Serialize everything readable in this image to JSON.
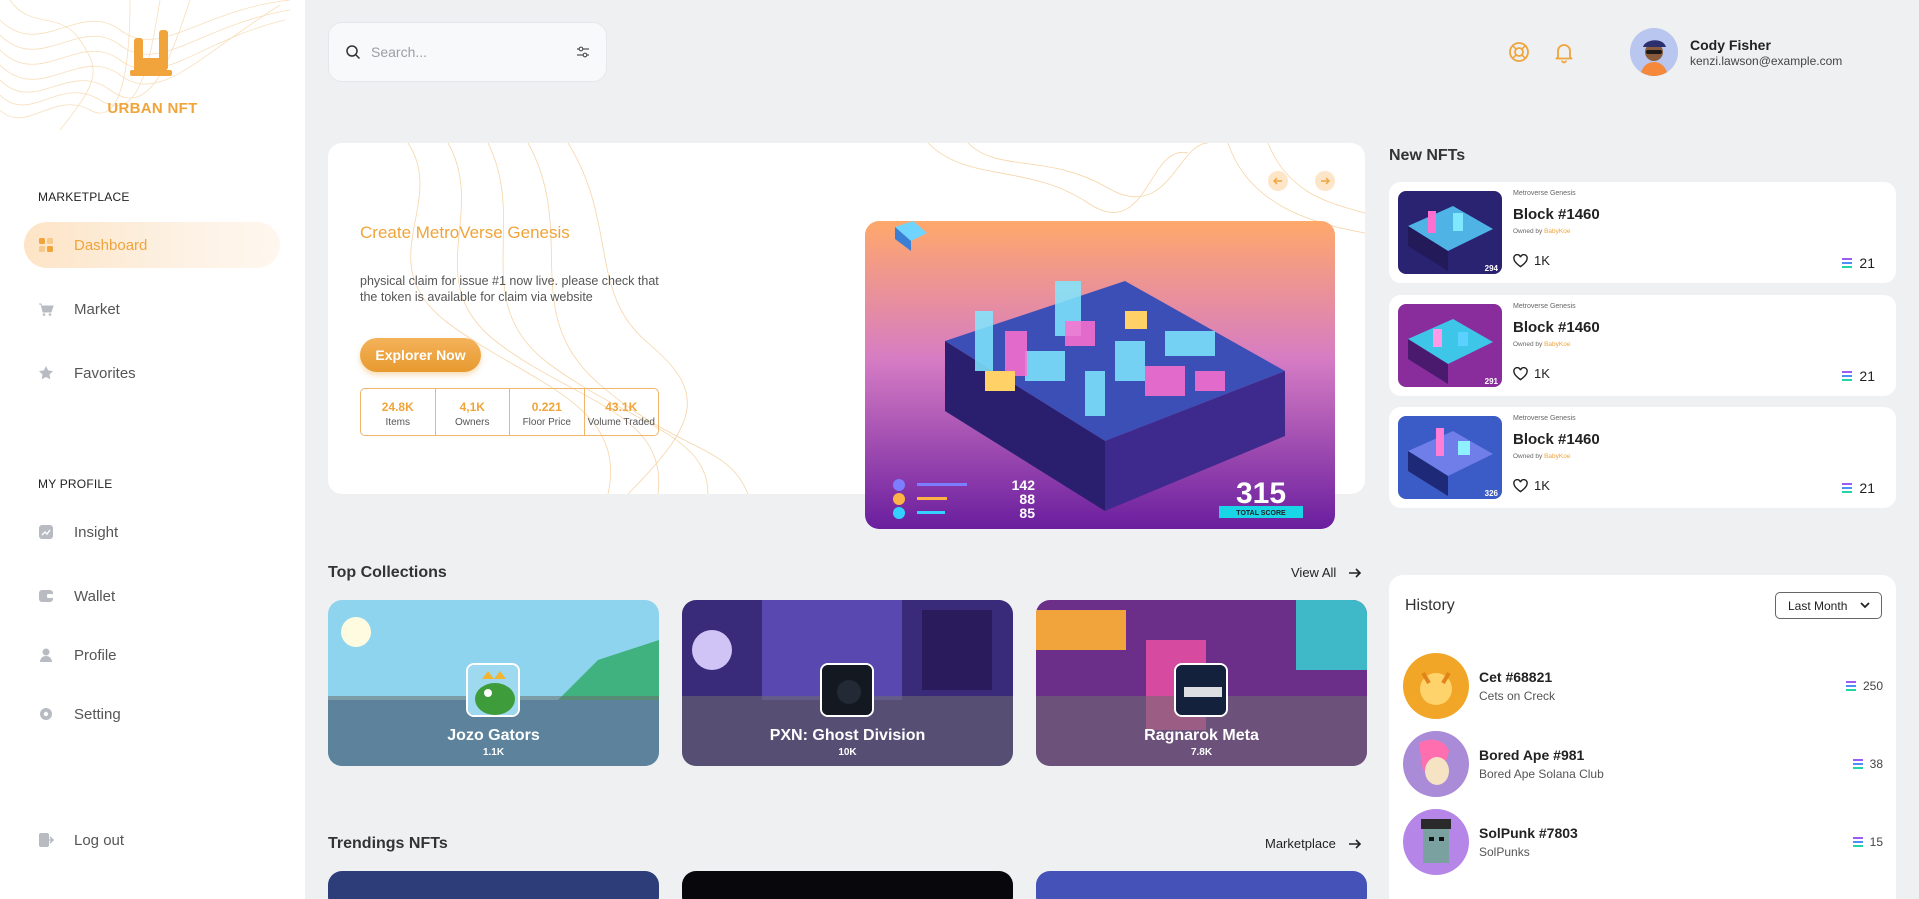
{
  "brand": {
    "name": "URBAN NFT"
  },
  "sidebar": {
    "sections": [
      {
        "label": "MARKETPLACE"
      },
      {
        "label": "MY PROFILE"
      }
    ],
    "items": [
      {
        "label": "Dashboard",
        "icon": "dashboard-icon",
        "active": true
      },
      {
        "label": "Market",
        "icon": "cart-icon"
      },
      {
        "label": "Favorites",
        "icon": "star-icon"
      },
      {
        "label": "Insight",
        "icon": "chart-icon"
      },
      {
        "label": "Wallet",
        "icon": "wallet-icon"
      },
      {
        "label": "Profile",
        "icon": "user-icon"
      },
      {
        "label": "Setting",
        "icon": "gear-icon"
      },
      {
        "label": "Log out",
        "icon": "logout-icon"
      }
    ]
  },
  "search": {
    "placeholder": "Search..."
  },
  "user": {
    "name": "Cody Fisher",
    "email": "kenzi.lawson@example.com"
  },
  "hero": {
    "title": "Create MetroVerse Genesis",
    "description": "physical claim for issue #1 now live. please check that the token is available for claim via website",
    "button": "Explorer Now",
    "stats": [
      {
        "value": "24.8K",
        "label": "Items"
      },
      {
        "value": "4,1K",
        "label": "Owners"
      },
      {
        "value": "0.221",
        "label": "Floor Price"
      },
      {
        "value": "43.1K",
        "label": "Volume Traded"
      }
    ],
    "image": {
      "bars": [
        "142",
        "88",
        "85"
      ],
      "score": "315",
      "score_label": "TOTAL SCORE"
    }
  },
  "top_collections": {
    "title": "Top Collections",
    "link": "View All",
    "items": [
      {
        "name": "Jozo Gators",
        "count": "1.1K"
      },
      {
        "name": "PXN: Ghost Division",
        "count": "10K"
      },
      {
        "name": "Ragnarok Meta",
        "count": "7.8K"
      }
    ]
  },
  "trending": {
    "title": "Trendings NFTs",
    "link": "Marketplace"
  },
  "new_nfts": {
    "title": "New NFTs",
    "items": [
      {
        "collection": "Metroverse Genesis",
        "name": "Block #1460",
        "owned_by": "Owned by",
        "owner": "BabyKoe",
        "likes": "1K",
        "price": "21",
        "thumb_num": "294"
      },
      {
        "collection": "Metroverse Genesis",
        "name": "Block #1460",
        "owned_by": "Owned by",
        "owner": "BabyKoe",
        "likes": "1K",
        "price": "21",
        "thumb_num": "291"
      },
      {
        "collection": "Metroverse Genesis",
        "name": "Block #1460",
        "owned_by": "Owned by",
        "owner": "BabyKoe",
        "likes": "1K",
        "price": "21",
        "thumb_num": "326"
      }
    ]
  },
  "history": {
    "title": "History",
    "filter": "Last Month",
    "items": [
      {
        "name": "Cet #68821",
        "sub": "Cets on Creck",
        "price": "250"
      },
      {
        "name": "Bored Ape #981",
        "sub": "Bored Ape Solana Club",
        "price": "38"
      },
      {
        "name": "SolPunk #7803",
        "sub": "SolPunks",
        "price": "15"
      }
    ]
  },
  "colors": {
    "accent": "#f0a43b",
    "background": "#eef0f2"
  }
}
